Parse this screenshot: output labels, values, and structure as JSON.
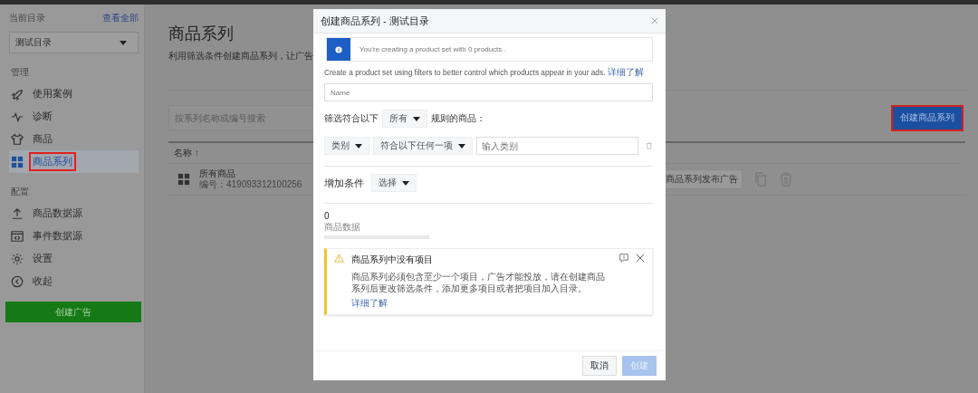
{
  "sidebar": {
    "catalog_label": "当前目录",
    "view_all": "查看全部",
    "catalog_select": "测试目录",
    "sections": [
      {
        "title": "管理",
        "items": [
          {
            "label": "使用案例",
            "selected": false,
            "highlighted": false
          },
          {
            "label": "诊断",
            "selected": false,
            "highlighted": false
          },
          {
            "label": "商品",
            "selected": false,
            "highlighted": false
          },
          {
            "label": "商品系列",
            "selected": true,
            "highlighted": true
          }
        ]
      },
      {
        "title": "配置",
        "items": [
          {
            "label": "商品数据源",
            "selected": false,
            "highlighted": false
          },
          {
            "label": "事件数据源",
            "selected": false,
            "highlighted": false
          },
          {
            "label": "设置",
            "selected": false,
            "highlighted": false
          },
          {
            "label": "收起",
            "selected": false,
            "highlighted": false
          }
        ]
      }
    ],
    "create_ad_button": "创建广告"
  },
  "main": {
    "title": "商品系列",
    "subtitle": "利用筛选条件创建商品系列，让广告",
    "search": {
      "placeholder": "按系列名称或编号搜索"
    },
    "create_button": {
      "label": "创建商品系列",
      "highlighted": true
    },
    "table": {
      "columns": [
        "名称 ↑"
      ],
      "rows": [
        {
          "name": "所有商品",
          "id": "编号：419093312100256",
          "action": "商品系列发布广告"
        }
      ]
    }
  },
  "modal": {
    "title": "创建商品系列 - 测试目录",
    "info": "You're creating a product set with 0 products .",
    "description": "Create a product set using filters to better control which products appear in your ads.",
    "description_link": "详细了解",
    "name": {
      "placeholder": "Name"
    },
    "filter": {
      "prefix": "筛选符合以下",
      "match": "所有",
      "suffix": "规则的商品："
    },
    "rule": {
      "field": "类别",
      "operator": "符合以下任何一项",
      "value": {
        "placeholder": "输入类别"
      }
    },
    "add_condition": {
      "label": "增加条件",
      "select": "选择"
    },
    "count": {
      "value": "0",
      "label": "商品数据",
      "level": 0
    },
    "warning": {
      "title": "商品系列中没有项目",
      "body": "商品系列必须包含至少一个项目，广告才能投放，请在创建商品系列后更改筛选条件，添加更多项目或者把项目加入目录。",
      "link": "详细了解"
    },
    "buttons": [
      {
        "label": "取消",
        "disabled": false
      },
      {
        "label": "创建",
        "disabled": true
      }
    ]
  }
}
